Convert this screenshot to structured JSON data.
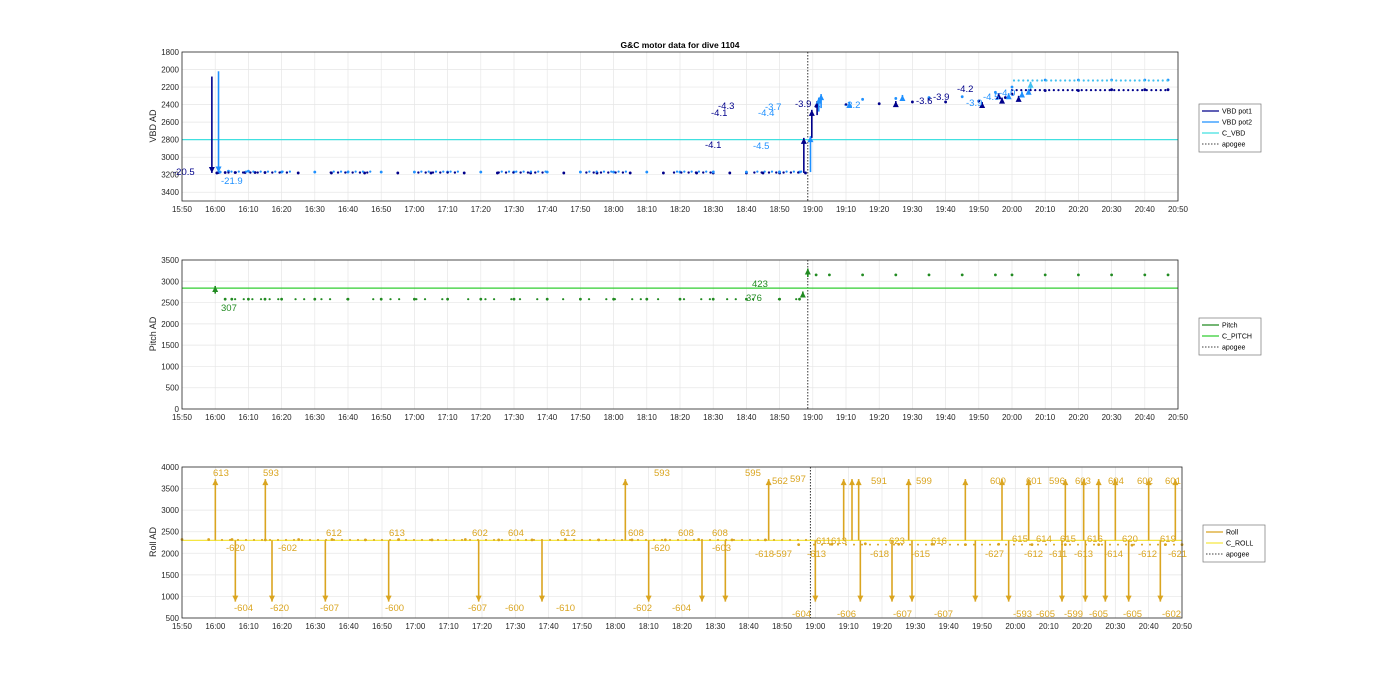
{
  "figure": {
    "title": "G&C motor data for dive 1104"
  },
  "chart_data": [
    {
      "type": "line",
      "title": "G&C motor data for dive 1104",
      "ylabel": "VBD AD",
      "ylim": [
        3500,
        1800
      ],
      "y_reversed": true,
      "yticks": [
        1800,
        2000,
        2200,
        2400,
        2600,
        2800,
        3000,
        3200,
        3400
      ],
      "xlim_minutes": [
        950,
        1250
      ],
      "xtick_labels": [
        "15:50",
        "16:00",
        "16:10",
        "16:20",
        "16:30",
        "16:40",
        "16:50",
        "17:00",
        "17:10",
        "17:20",
        "17:30",
        "17:40",
        "17:50",
        "18:00",
        "18:10",
        "18:20",
        "18:30",
        "18:40",
        "18:50",
        "19:00",
        "19:10",
        "19:20",
        "19:30",
        "19:40",
        "19:50",
        "20:00",
        "20:10",
        "20:20",
        "20:30",
        "20:40",
        "20:50"
      ],
      "grid": true,
      "legend": {
        "placement": "right",
        "entries": [
          {
            "name": "VBD pot1",
            "color": "#00008b",
            "style": "solid"
          },
          {
            "name": "VBD pot2",
            "color": "#1e90ff",
            "style": "solid"
          },
          {
            "name": "C_VBD",
            "color": "#40e0e0",
            "style": "solid"
          },
          {
            "name": "apogee",
            "color": "#000000",
            "style": "dotted"
          }
        ]
      },
      "series": [
        {
          "name": "VBD pot1",
          "color": "#00008b",
          "x": [
            960.5,
            961,
            963,
            966,
            969,
            972,
            975,
            985,
            995,
            1005,
            1015,
            1025,
            1035,
            1045,
            1055,
            1065,
            1075,
            1085,
            1095,
            1105,
            1110,
            1115,
            1120,
            1125,
            1130,
            1137.8,
            1141,
            1150,
            1160,
            1170,
            1175,
            1180,
            1190,
            1198,
            1200,
            1210,
            1220,
            1230,
            1240,
            1247
          ],
          "y": [
            3180,
            3175,
            3175,
            3175,
            3175,
            3175,
            3175,
            3180,
            3180,
            3180,
            3180,
            3180,
            3180,
            3180,
            3180,
            3180,
            3180,
            3180,
            3180,
            3180,
            3180,
            3180,
            3180,
            3180,
            3180,
            3180,
            2420,
            2400,
            2390,
            2370,
            2330,
            2370,
            2360,
            2320,
            2280,
            2240,
            2240,
            2230,
            2230,
            2230
          ]
        },
        {
          "name": "VBD pot2",
          "color": "#1e90ff",
          "x": [
            961.5,
            964,
            970,
            980,
            990,
            1000,
            1010,
            1020,
            1030,
            1040,
            1050,
            1060,
            1070,
            1080,
            1090,
            1100,
            1110,
            1120,
            1130,
            1136,
            1142,
            1155,
            1165,
            1175,
            1185,
            1195,
            1200,
            1210,
            1220,
            1230,
            1240,
            1247
          ],
          "y": [
            3170,
            3160,
            3160,
            3170,
            3170,
            3170,
            3170,
            3170,
            3170,
            3170,
            3170,
            3170,
            3170,
            3170,
            3170,
            3170,
            3170,
            3170,
            3170,
            3170,
            2360,
            2340,
            2330,
            2320,
            2310,
            2260,
            2200,
            2120,
            2120,
            2120,
            2120,
            2120
          ]
        },
        {
          "name": "C_VBD",
          "color": "#40e0e0",
          "constant": 2800
        }
      ],
      "annotations": [
        {
          "text": "-20.5",
          "color": "#00008b"
        },
        {
          "text": "-21.9",
          "color": "#1e90ff"
        },
        {
          "text": "-4.1",
          "color": "#00008b"
        },
        {
          "text": "-4.5",
          "color": "#1e90ff"
        },
        {
          "text": "-4.1",
          "color": "#00008b"
        },
        {
          "text": "-4.3",
          "color": "#00008b"
        },
        {
          "text": "-4.4",
          "color": "#1e90ff"
        },
        {
          "text": "-3.7",
          "color": "#1e90ff"
        },
        {
          "text": "-3.9",
          "color": "#00008b"
        },
        {
          "text": "-3.2",
          "color": "#1e90ff"
        },
        {
          "text": "-3.6",
          "color": "#00008b"
        },
        {
          "text": "-3.9",
          "color": "#00008b"
        },
        {
          "text": "-4.2",
          "color": "#00008b"
        },
        {
          "text": "-3.9",
          "color": "#1e90ff"
        },
        {
          "text": "-4.5",
          "color": "#1e90ff"
        },
        {
          "text": "-4.0",
          "color": "#1e90ff"
        }
      ],
      "apogee_minutes": 1138.5
    },
    {
      "type": "line",
      "ylabel": "Pitch AD",
      "ylim": [
        0,
        3500
      ],
      "yticks": [
        0,
        500,
        1000,
        1500,
        2000,
        2500,
        3000,
        3500
      ],
      "xlim_minutes": [
        950,
        1250
      ],
      "xtick_labels": [
        "15:50",
        "16:00",
        "16:10",
        "16:20",
        "16:30",
        "16:40",
        "16:50",
        "17:00",
        "17:10",
        "17:20",
        "17:30",
        "17:40",
        "17:50",
        "18:00",
        "18:10",
        "18:20",
        "18:30",
        "18:40",
        "18:50",
        "19:00",
        "19:10",
        "19:20",
        "19:30",
        "19:40",
        "19:50",
        "20:00",
        "20:10",
        "20:20",
        "20:30",
        "20:40",
        "20:50"
      ],
      "grid": true,
      "legend": {
        "placement": "right",
        "entries": [
          {
            "name": "Pitch",
            "color": "#228b22",
            "style": "solid"
          },
          {
            "name": "C_PITCH",
            "color": "#32cd32",
            "style": "solid"
          },
          {
            "name": "apogee",
            "color": "#000000",
            "style": "dotted"
          }
        ]
      },
      "series": [
        {
          "name": "Pitch",
          "color": "#228b22",
          "x": [
            963,
            965,
            970,
            975,
            980,
            990,
            1000,
            1010,
            1020,
            1030,
            1040,
            1050,
            1060,
            1070,
            1080,
            1090,
            1100,
            1110,
            1120,
            1130,
            1136,
            1141,
            1145,
            1155,
            1165,
            1175,
            1185,
            1195,
            1200,
            1210,
            1220,
            1230,
            1240,
            1247
          ],
          "y": [
            2580,
            2580,
            2580,
            2580,
            2580,
            2580,
            2580,
            2580,
            2580,
            2580,
            2580,
            2580,
            2580,
            2580,
            2580,
            2580,
            2580,
            2580,
            2580,
            2580,
            2580,
            3150,
            3150,
            3150,
            3150,
            3150,
            3150,
            3150,
            3150,
            3150,
            3150,
            3150,
            3150,
            3150
          ]
        },
        {
          "name": "C_PITCH",
          "color": "#32cd32",
          "constant": 2840
        }
      ],
      "annotations": [
        {
          "text": "307",
          "color": "#228b22"
        },
        {
          "text": "376",
          "color": "#228b22"
        },
        {
          "text": "423",
          "color": "#228b22"
        }
      ],
      "apogee_minutes": 1138.5
    },
    {
      "type": "line",
      "ylabel": "Roll AD",
      "ylim": [
        500,
        4000
      ],
      "yticks": [
        500,
        1000,
        1500,
        2000,
        2500,
        3000,
        3500,
        4000
      ],
      "xlim_minutes": [
        950,
        1250
      ],
      "xtick_labels": [
        "15:50",
        "16:00",
        "16:10",
        "16:20",
        "16:30",
        "16:40",
        "16:50",
        "17:00",
        "17:10",
        "17:20",
        "17:30",
        "17:40",
        "17:50",
        "18:00",
        "18:10",
        "18:20",
        "18:30",
        "18:40",
        "18:50",
        "19:00",
        "19:10",
        "19:20",
        "19:30",
        "19:40",
        "19:50",
        "20:00",
        "20:10",
        "20:20",
        "20:30",
        "20:40",
        "20:50"
      ],
      "grid": true,
      "legend": {
        "placement": "right",
        "entries": [
          {
            "name": "Roll",
            "color": "#daa520",
            "style": "solid"
          },
          {
            "name": "C_ROLL",
            "color": "#f5e642",
            "style": "solid"
          },
          {
            "name": "apogee",
            "color": "#000000",
            "style": "dotted"
          }
        ]
      },
      "series": [
        {
          "name": "Roll",
          "color": "#daa520",
          "x": [
            950,
            958,
            965,
            975,
            985,
            995,
            1005,
            1015,
            1025,
            1035,
            1045,
            1055,
            1065,
            1075,
            1085,
            1095,
            1105,
            1115,
            1125,
            1135,
            1145,
            1155,
            1165,
            1175,
            1185,
            1195,
            1205,
            1215,
            1225,
            1235,
            1245,
            1250
          ],
          "y": [
            2320,
            2320,
            2320,
            2310,
            2320,
            2320,
            2310,
            2320,
            2310,
            2320,
            2310,
            2310,
            2320,
            2310,
            2310,
            2310,
            2320,
            2310,
            2310,
            2200,
            2210,
            2220,
            2210,
            2210,
            2200,
            2210,
            2200,
            2200,
            2200,
            2190,
            2200,
            2200
          ]
        },
        {
          "name": "C_ROLL",
          "color": "#f5e642",
          "constant": 2300
        }
      ],
      "annotations_up": [
        "613",
        "593",
        "612",
        "613",
        "602",
        "604",
        "612",
        "608",
        "593",
        "608",
        "608",
        "595",
        "562",
        "597",
        "611",
        "613",
        "591",
        "623",
        "599",
        "616",
        "600",
        "615",
        "601",
        "614",
        "596",
        "615",
        "603",
        "616",
        "604",
        "620",
        "602",
        "619",
        "601"
      ],
      "annotations_down": [
        "-620",
        "-604",
        "-602",
        "-620",
        "-607",
        "-600",
        "-607",
        "-600",
        "-610",
        "-602",
        "-620",
        "-604",
        "-603",
        "-618",
        "-597",
        "-604",
        "-613",
        "-606",
        "-618",
        "-607",
        "-615",
        "-607",
        "-627",
        "-593",
        "-612",
        "-605",
        "-611",
        "-599",
        "-613",
        "-605",
        "-614",
        "-605",
        "-612",
        "-602",
        "-621"
      ],
      "apogee_minutes": 1138.5
    }
  ]
}
